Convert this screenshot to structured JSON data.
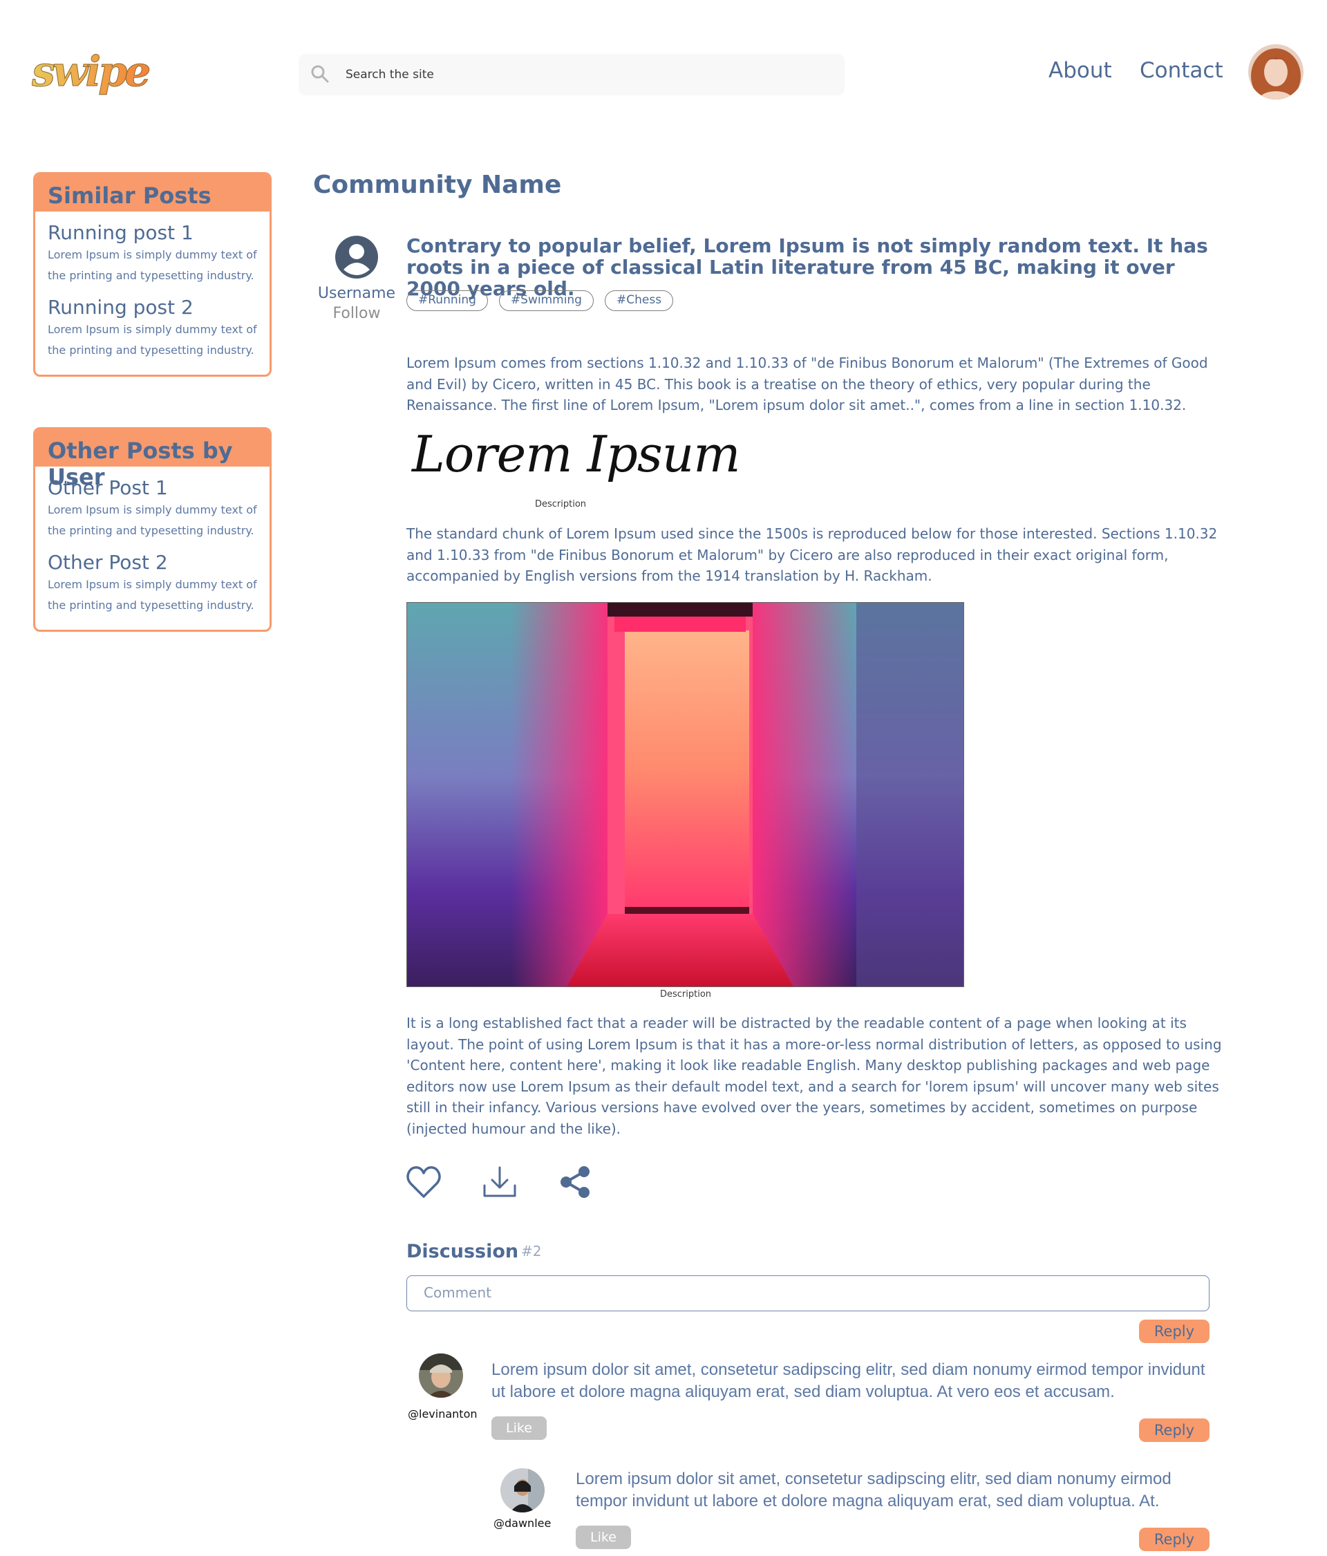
{
  "header": {
    "logo_text": "swipe",
    "search_placeholder": "Search the site",
    "nav": [
      "About",
      "Contact"
    ]
  },
  "sidebar": {
    "similar": {
      "title": "Similar Posts",
      "items": [
        {
          "title": "Running post 1",
          "text": "Lorem Ipsum is simply dummy text of the printing and typesetting industry."
        },
        {
          "title": "Running post 2",
          "text": "Lorem Ipsum is simply dummy text of the printing and typesetting industry."
        }
      ]
    },
    "other": {
      "title": "Other Posts by User",
      "items": [
        {
          "title": "Other Post 1",
          "text": "Lorem Ipsum is simply dummy text of the printing and typesetting industry."
        },
        {
          "title": "Other Post 2",
          "text": "Lorem Ipsum is simply dummy text of the printing and typesetting industry."
        }
      ]
    }
  },
  "main": {
    "community": "Community Name",
    "author": {
      "name": "Username",
      "follow": "Follow"
    },
    "title": "Contrary to popular belief, Lorem Ipsum is not simply random text. It has roots in a piece of classical Latin literature from 45 BC, making it over 2000 years old.",
    "tags": [
      "#Running",
      "#Swimming",
      "#Chess"
    ],
    "paragraphs": [
      "Lorem Ipsum comes from sections 1.10.32 and 1.10.33 of \"de Finibus Bonorum et Malorum\" (The Extremes of Good and Evil) by Cicero, written in 45 BC. This book is a treatise on the theory of ethics, very popular during the Renaissance. The first line of Lorem Ipsum, \"Lorem ipsum dolor sit amet..\", comes from a line in section 1.10.32.",
      "The standard chunk of Lorem Ipsum used since the 1500s is reproduced below for those interested. Sections 1.10.32 and 1.10.33 from \"de Finibus Bonorum et Malorum\" by Cicero are also reproduced in their exact original form, accompanied by English versions from the 1914 translation by H. Rackham.",
      "It is a long established fact that a reader will be distracted by the readable content of a page when looking at its layout. The point of using Lorem Ipsum is that it has a more-or-less normal distribution of letters, as opposed to using 'Content here, content here', making it look like readable English. Many desktop publishing packages and web page editors now use Lorem Ipsum as their default model text, and a search for 'lorem ipsum' will uncover many web sites still in their infancy. Various versions have evolved over the years, sometimes by accident, sometimes on purpose (injected humour and the like)."
    ],
    "figure1": {
      "logo_text": "Lorem Ipsum",
      "caption": "Description"
    },
    "figure2": {
      "caption": "Description"
    }
  },
  "discussion": {
    "title": "Discussion",
    "count": "#2",
    "comment_placeholder": "Comment",
    "reply_label": "Reply",
    "like_label": "Like",
    "comments": [
      {
        "handle": "@levinanton",
        "text": "Lorem ipsum dolor sit amet, consetetur sadipscing elitr, sed diam nonumy eirmod tempor invidunt ut labore et dolore magna aliquyam erat, sed diam voluptua. At vero eos et accusam."
      },
      {
        "handle": "@dawnlee",
        "text": "Lorem ipsum dolor sit amet, consetetur sadipscing elitr, sed diam nonumy eirmod tempor invidunt ut labore et dolore magna aliquyam erat, sed diam voluptua. At."
      }
    ]
  },
  "colors": {
    "accent": "#f89a6c",
    "text": "#4f6b94",
    "like": "#c3c3c3"
  }
}
